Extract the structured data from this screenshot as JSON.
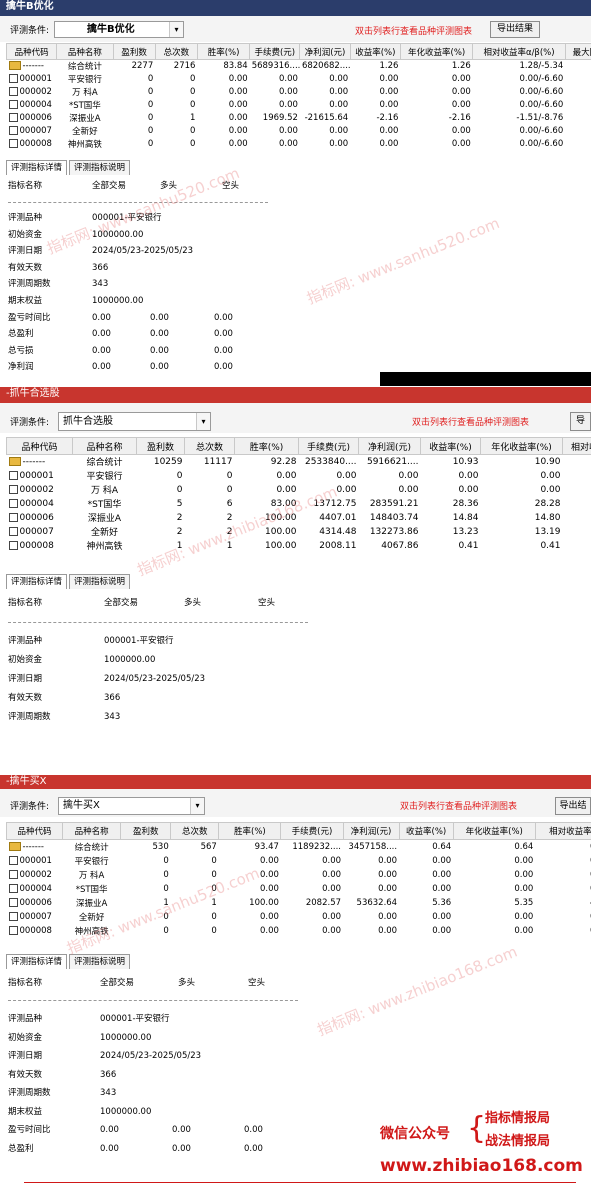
{
  "colors": {
    "titlebar_dark": "#2b3d6b",
    "titlebar_red": "#c8352e",
    "hint_red": "#e02020",
    "accent": "#d01818"
  },
  "columns1": [
    "品种代码",
    "品种名称",
    "盈利数",
    "总次数",
    "胜率(%)",
    "手续费(元)",
    "净利润(元)",
    "收益率(%)",
    "年化收益率(%)",
    "相对收益率α/β(%)",
    "最大回"
  ],
  "columns2": [
    "品种代码",
    "品种名称",
    "盈利数",
    "总次数",
    "胜率(%)",
    "手续费(元)",
    "净利润(元)",
    "收益率(%)",
    "年化收益率(%)",
    "相对收"
  ],
  "columns3": [
    "品种代码",
    "品种名称",
    "盈利数",
    "总次数",
    "胜率(%)",
    "手续费(元)",
    "净利润(元)",
    "收益率(%)",
    "年化收益率(%)",
    "相对收益率"
  ],
  "tabs": [
    "评测指标详情",
    "评测指标说明"
  ],
  "stat_headers": [
    "指标名称",
    "全部交易",
    "多头",
    "空头"
  ],
  "panel1": {
    "title": "擒牛B优化",
    "cond_label": "评测条件:",
    "cond_value": "擒牛B优化",
    "hint": "双击列表行查看品种评测图表",
    "export": "导出结果",
    "rows": [
      [
        "-------",
        "综合统计",
        "2277",
        "2716",
        "83.84",
        "5689316....",
        "6820682....",
        "1.26",
        "1.26",
        "1.28/-5.34",
        "64"
      ],
      [
        "000001",
        "平安银行",
        "0",
        "0",
        "0.00",
        "0.00",
        "0.00",
        "0.00",
        "0.00",
        "0.00/-6.60",
        ""
      ],
      [
        "000002",
        "万 科A",
        "0",
        "0",
        "0.00",
        "0.00",
        "0.00",
        "0.00",
        "0.00",
        "0.00/-6.60",
        ""
      ],
      [
        "000004",
        "*ST国华",
        "0",
        "0",
        "0.00",
        "0.00",
        "0.00",
        "0.00",
        "0.00",
        "0.00/-6.60",
        ""
      ],
      [
        "000006",
        "深振业A",
        "0",
        "1",
        "0.00",
        "1969.52",
        "-21615.64",
        "-2.16",
        "-2.16",
        "-1.51/-8.76",
        "21"
      ],
      [
        "000007",
        "全新好",
        "0",
        "0",
        "0.00",
        "0.00",
        "0.00",
        "0.00",
        "0.00",
        "0.00/-6.60",
        ""
      ],
      [
        "000008",
        "神州高铁",
        "0",
        "0",
        "0.00",
        "0.00",
        "0.00",
        "0.00",
        "0.00",
        "0.00/-6.60",
        ""
      ]
    ],
    "stats": [
      [
        "评测品种",
        "000001-平安银行"
      ],
      [
        "初始资金",
        "1000000.00"
      ],
      [
        "评测日期",
        "2024/05/23-2025/05/23"
      ],
      [
        "有效天数",
        "366"
      ],
      [
        "评测周期数",
        "343"
      ],
      [
        "期末权益",
        "1000000.00"
      ],
      [
        "盈亏时间比",
        "0.00",
        "0.00",
        "0.00"
      ],
      [
        "总盈利",
        "0.00",
        "0.00",
        "0.00"
      ],
      [
        "总亏损",
        "0.00",
        "0.00",
        "0.00"
      ],
      [
        "净利润",
        "0.00",
        "0.00",
        "0.00"
      ]
    ]
  },
  "panel2": {
    "title": "-抓牛合选股",
    "cond_label": "评测条件:",
    "cond_value": "抓牛合选股",
    "hint": "双击列表行查看品种评测图表",
    "export": "导",
    "rows": [
      [
        "-------",
        "综合统计",
        "10259",
        "11117",
        "92.28",
        "2533840....",
        "5916621....",
        "10.93",
        "10.90",
        ""
      ],
      [
        "000001",
        "平安银行",
        "0",
        "0",
        "0.00",
        "0.00",
        "0.00",
        "0.00",
        "0.00",
        ""
      ],
      [
        "000002",
        "万 科A",
        "0",
        "0",
        "0.00",
        "0.00",
        "0.00",
        "0.00",
        "0.00",
        ""
      ],
      [
        "000004",
        "*ST国华",
        "5",
        "6",
        "83.00",
        "13712.75",
        "283591.21",
        "28.36",
        "28.28",
        "2"
      ],
      [
        "000006",
        "深振业A",
        "2",
        "2",
        "100.00",
        "4407.01",
        "148403.74",
        "14.84",
        "14.80",
        ""
      ],
      [
        "000007",
        "全新好",
        "2",
        "2",
        "100.00",
        "4314.48",
        "132273.86",
        "13.23",
        "13.19",
        ""
      ],
      [
        "000008",
        "神州高铁",
        "1",
        "1",
        "100.00",
        "2008.11",
        "4067.86",
        "0.41",
        "0.41",
        ""
      ]
    ],
    "stats": [
      [
        "评测品种",
        "000001-平安银行"
      ],
      [
        "初始资金",
        "1000000.00"
      ],
      [
        "评测日期",
        "2024/05/23-2025/05/23"
      ],
      [
        "有效天数",
        "366"
      ],
      [
        "评测周期数",
        "343"
      ]
    ]
  },
  "panel3": {
    "title": "-擒牛买X",
    "cond_label": "评测条件:",
    "cond_value": "擒牛买X",
    "hint": "双击列表行查看品种评测图表",
    "export": "导出结",
    "rows": [
      [
        "-------",
        "综合统计",
        "530",
        "567",
        "93.47",
        "1189232....",
        "3457158....",
        "0.64",
        "0.64",
        "0.5"
      ],
      [
        "000001",
        "平安银行",
        "0",
        "0",
        "0.00",
        "0.00",
        "0.00",
        "0.00",
        "0.00",
        "0.0"
      ],
      [
        "000002",
        "万 科A",
        "0",
        "0",
        "0.00",
        "0.00",
        "0.00",
        "0.00",
        "0.00",
        "0.0"
      ],
      [
        "000004",
        "*ST国华",
        "0",
        "0",
        "0.00",
        "0.00",
        "0.00",
        "0.00",
        "0.00",
        "0.0"
      ],
      [
        "000006",
        "深振业A",
        "1",
        "1",
        "100.00",
        "2082.57",
        "53632.64",
        "5.36",
        "5.35",
        "4.2"
      ],
      [
        "000007",
        "全新好",
        "0",
        "0",
        "0.00",
        "0.00",
        "0.00",
        "0.00",
        "0.00",
        "0.0"
      ],
      [
        "000008",
        "神州高铁",
        "0",
        "0",
        "0.00",
        "0.00",
        "0.00",
        "0.00",
        "0.00",
        "0.0"
      ]
    ],
    "stats": [
      [
        "评测品种",
        "000001-平安银行"
      ],
      [
        "初始资金",
        "1000000.00"
      ],
      [
        "评测日期",
        "2024/05/23-2025/05/23"
      ],
      [
        "有效天数",
        "366"
      ],
      [
        "评测周期数",
        "343"
      ],
      [
        "期末权益",
        "1000000.00"
      ],
      [
        "盈亏时间比",
        "0.00",
        "0.00",
        "0.00"
      ],
      [
        "总盈利",
        "0.00",
        "0.00",
        "0.00"
      ]
    ]
  },
  "watermarks": [
    "指标网: www.sanhu520.com",
    "指标网: www.zhibiao168.com"
  ],
  "footer": {
    "wechat": "微信公众号",
    "brand1": "指标情报局",
    "brand2": "战法情报局",
    "url": "www.zhibiao168.com"
  }
}
